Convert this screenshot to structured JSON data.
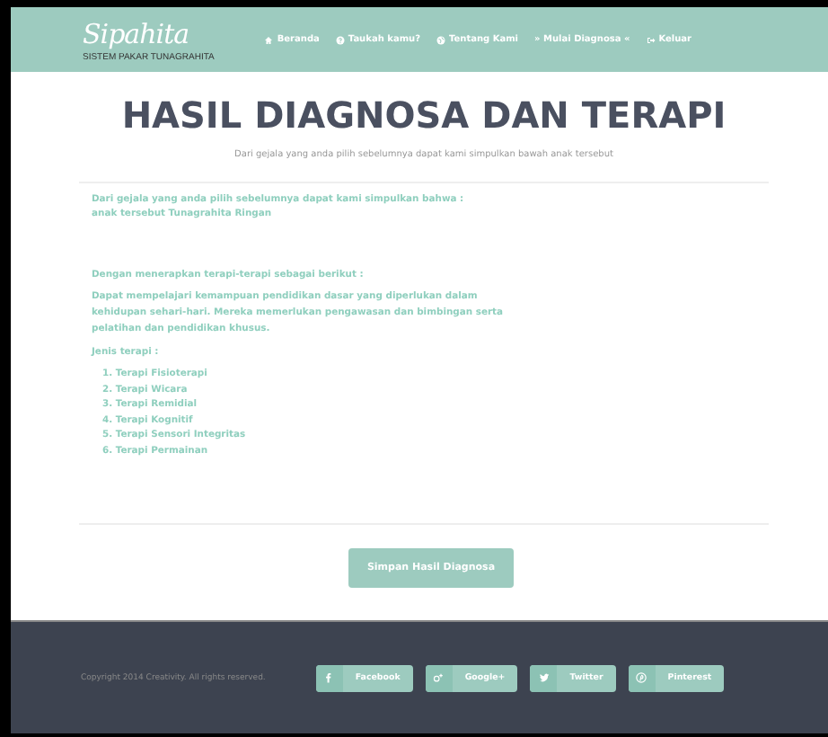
{
  "header": {
    "logo": "Sipahita",
    "tagline": "SISTEM PAKAR TUNAGRAHITA",
    "nav": [
      {
        "label": "Beranda"
      },
      {
        "label": "Taukah kamu?"
      },
      {
        "label": "Tentang Kami"
      },
      {
        "label": "» Mulai Diagnosa «"
      },
      {
        "label": "Keluar"
      }
    ]
  },
  "title": "HASIL DIAGNOSA DAN TERAPI",
  "subtitle": "Dari gejala yang anda pilih sebelumnya dapat kami simpulkan bawah anak tersebut",
  "result": [
    "Dari gejala yang anda pilih sebelumnya dapat kami simpulkan bahwa :",
    "anak tersebut Tunagrahita Ringan"
  ],
  "therapy_intro": "Dengan menerapkan terapi-terapi sebagai berikut :",
  "therapy_text": "Dapat mempelajari kemampuan pendidikan dasar yang diperlukan dalam kehidupan sehari-hari. Mereka memerlukan pengawasan dan bimbingan serta pelatihan dan pendidikan khusus.",
  "therapy_types_label": "Jenis terapi :",
  "therapy_types": [
    "1. Terapi Fisioterapi",
    "2. Terapi Wicara",
    "3. Terapi Remidial",
    "4. Terapi Kognitif",
    "5. Terapi Sensori Integritas",
    "6. Terapi Permainan"
  ],
  "save_button": "Simpan Hasil Diagnosa",
  "footer": {
    "copyright": "Copyright 2014 Creativity. All rights reserved.",
    "social": [
      {
        "label": "Facebook"
      },
      {
        "label": "Google+"
      },
      {
        "label": "Twitter"
      },
      {
        "label": "Pinterest"
      }
    ]
  }
}
